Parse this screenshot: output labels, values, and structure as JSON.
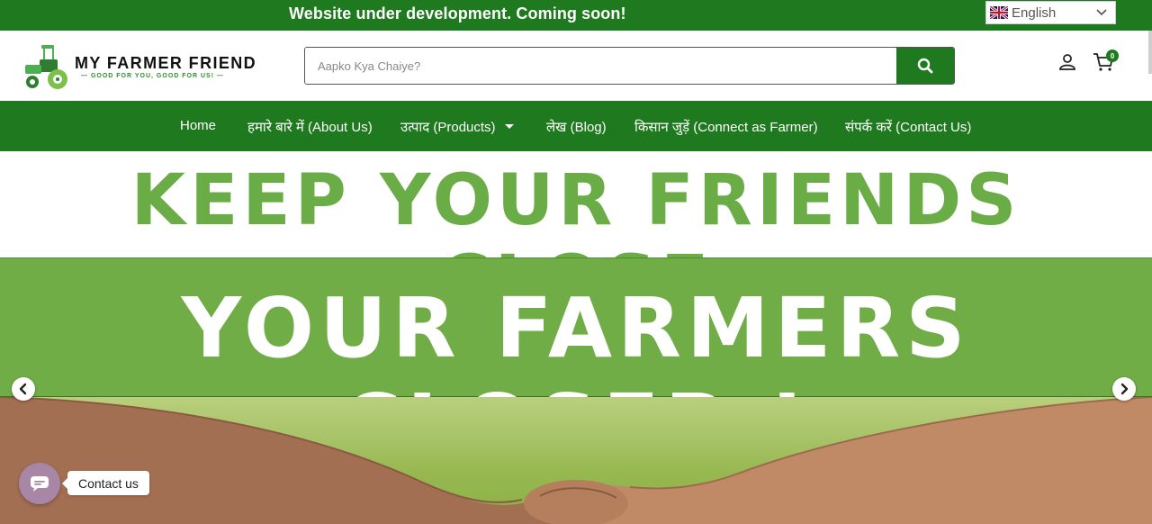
{
  "notice_bar": {
    "text": "Website under development. Coming soon!",
    "language": {
      "flag_icon": "uk-flag-icon",
      "label": "English",
      "caret_icon": "chevron-down-icon"
    }
  },
  "header": {
    "logo": {
      "brand": "MY FARMER FRIEND",
      "tagline": "— GOOD FOR YOU, GOOD FOR US! —",
      "icon": "tractor-icon"
    },
    "search": {
      "placeholder": "Aapko Kya Chaiye?",
      "value": "",
      "button_icon": "search-icon"
    },
    "account_icon": "user-icon",
    "cart": {
      "icon": "cart-icon",
      "count": "0"
    }
  },
  "nav": {
    "items": [
      {
        "label": "Home"
      },
      {
        "label": "हमारे बारे में (About Us)"
      },
      {
        "label": "उत्पाद (Products)",
        "has_dropdown": true
      },
      {
        "label": "लेख (Blog)"
      },
      {
        "label": "किसान जुड़ें (Connect as Farmer)"
      },
      {
        "label": "संपर्क करें (Contact Us)"
      }
    ]
  },
  "hero": {
    "line1": "KEEP YOUR FRIENDS CLOSE",
    "line2": "YOUR FARMERS CLOSER !",
    "prev_icon": "chevron-left-icon",
    "next_icon": "chevron-right-icon"
  },
  "contact_widget": {
    "label": "Contact us",
    "icon": "chat-icon"
  },
  "colors": {
    "brand_green": "#1f7a1f",
    "light_green": "#70ad47",
    "headline_green": "#6aac46"
  }
}
